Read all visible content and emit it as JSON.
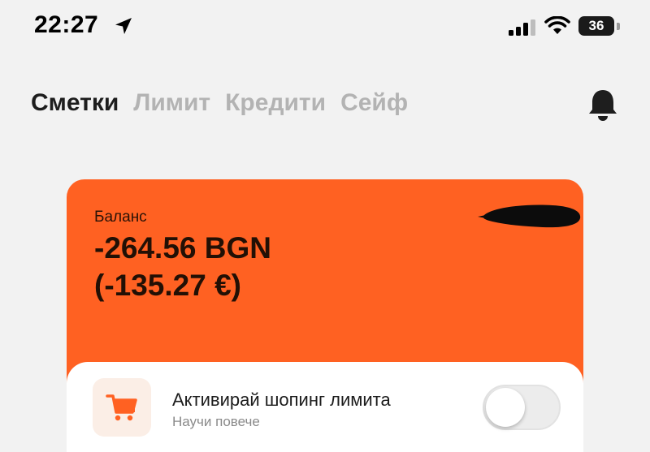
{
  "status_bar": {
    "time": "22:27",
    "battery": "36",
    "icons": [
      "location-arrow-icon",
      "cellular-signal-icon",
      "wifi-icon",
      "battery-icon"
    ]
  },
  "tabs": [
    {
      "label": "Сметки",
      "active": true
    },
    {
      "label": "Лимит",
      "active": false
    },
    {
      "label": "Кредити",
      "active": false
    },
    {
      "label": "Сейф",
      "active": false
    }
  ],
  "header": {
    "notification_icon": "bell-icon"
  },
  "balance_card": {
    "label": "Баланс",
    "amount": "-264.56 BGN",
    "amount_eur": "(-135.27 €)",
    "color": "#ff6122"
  },
  "shopping_limit": {
    "icon": "shopping-cart-icon",
    "title": "Активирай шопинг лимита",
    "subtitle": "Научи повече",
    "toggle_on": false,
    "accent": "#ff6122"
  }
}
